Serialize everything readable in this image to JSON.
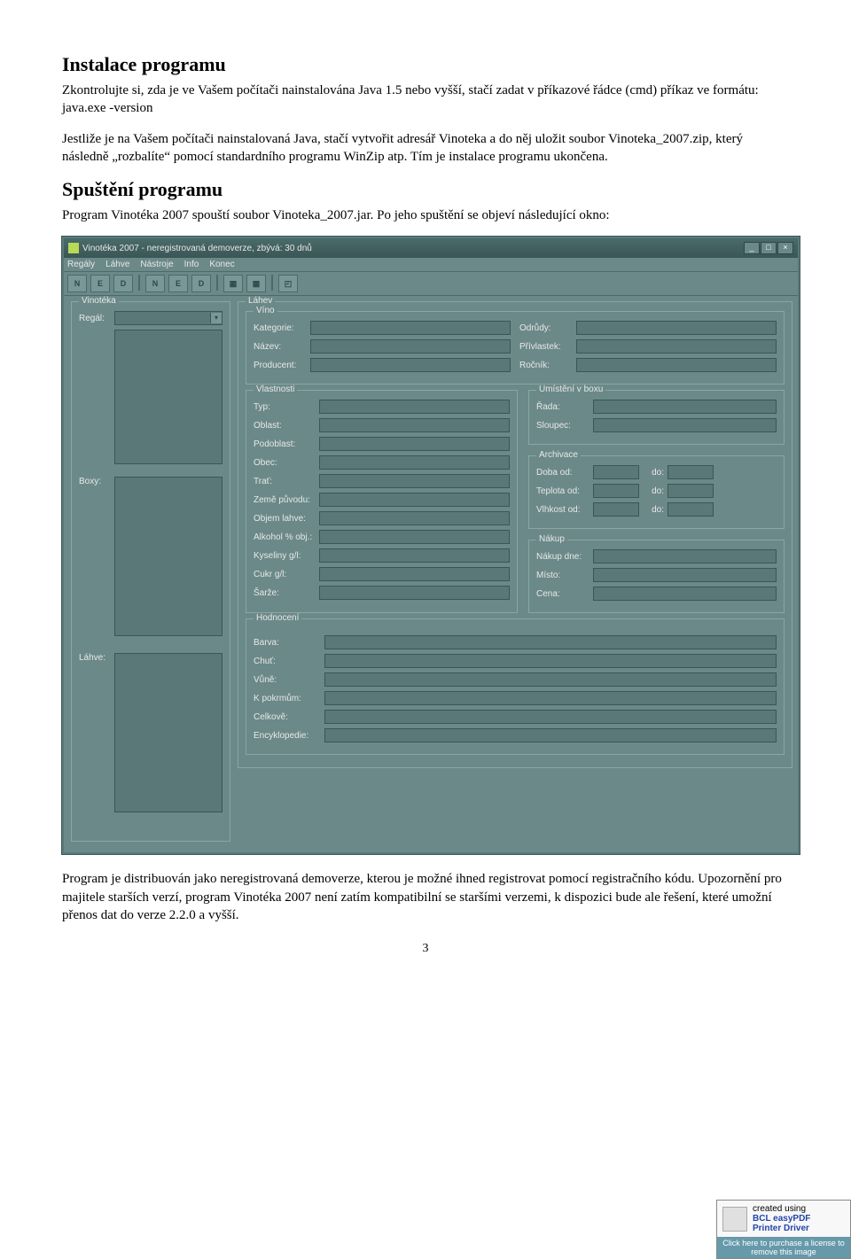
{
  "doc": {
    "h_install": "Instalace programu",
    "p_install_1": "Zkontrolujte si, zda je ve Vašem počítači nainstalována Java 1.5 nebo vyšší, stačí zadat v příkazové řádce (cmd) příkaz ve formátu: java.exe -version",
    "p_install_2": "Jestliže je na Vašem počítači nainstalovaná Java, stačí vytvořit adresář Vinoteka a do něj uložit soubor Vinoteka_2007.zip, který následně „rozbalíte“ pomocí standardního programu WinZip atp. Tím je instalace programu ukončena.",
    "h_launch": "Spuštění programu",
    "p_launch_1": "Program Vinotéka 2007 spouští soubor Vinoteka_2007.jar. Po jeho spuštění se objeví následující okno:",
    "p_after": "Program je distribuován jako neregistrovaná demoverze, kterou je možné ihned registrovat pomocí registračního kódu. Upozornění pro majitele starších verzí, program Vinotéka 2007 není zatím kompatibilní se staršími verzemi, k dispozici bude ale řešení, které umožní přenos dat do verze 2.2.0 a vyšší.",
    "page_num": "3"
  },
  "win": {
    "title": "Vinotéka 2007 - neregistrovaná demoverze, zbývá: 30 dnů",
    "menu": [
      "Regály",
      "Láhve",
      "Nástroje",
      "Info",
      "Konec"
    ],
    "toolbar": [
      "N",
      "E",
      "D",
      "N",
      "E",
      "D",
      "▦",
      "▦",
      "◰"
    ]
  },
  "left": {
    "group_title": "Vinotéka",
    "regal_lbl": "Regál:",
    "boxy_lbl": "Boxy:",
    "lahve_lbl": "Láhve:"
  },
  "lahev": {
    "group_title": "Láhev",
    "vino": {
      "title": "Víno",
      "kategorie": "Kategorie:",
      "nazev": "Název:",
      "producent": "Producent:",
      "odrudy": "Odrůdy:",
      "privlastek": "Přívlastek:",
      "rocnik": "Ročník:"
    },
    "vlastnosti": {
      "title": "Vlastnosti",
      "typ": "Typ:",
      "oblast": "Oblast:",
      "podoblast": "Podoblast:",
      "obec": "Obec:",
      "trat": "Trať:",
      "zeme": "Země původu:",
      "objem": "Objem lahve:",
      "alkohol": "Alkohol % obj.:",
      "kyseliny": "Kyseliny g/l:",
      "cukr": "Cukr g/l:",
      "sarze": "Šarže:"
    },
    "umisteni": {
      "title": "Umístění v boxu",
      "rada": "Řada:",
      "sloupec": "Sloupec:"
    },
    "archivace": {
      "title": "Archivace",
      "doba_od": "Doba od:",
      "teplota_od": "Teplota od:",
      "vlhkost_od": "Vlhkost od:",
      "do": "do:"
    },
    "nakup": {
      "title": "Nákup",
      "nakup_dne": "Nákup dne:",
      "misto": "Místo:",
      "cena": "Cena:"
    },
    "hodnoceni": {
      "title": "Hodnocení",
      "barva": "Barva:",
      "chut": "Chuť:",
      "vune": "Vůně:",
      "kpokrmum": "K pokrmům:",
      "celkove": "Celkově:",
      "encyklopedie": "Encyklopedie:"
    }
  },
  "ad": {
    "line1": "created using",
    "line2": "BCL easyPDF",
    "line3": "Printer Driver",
    "bar": "Click here to purchase a license to remove this image"
  }
}
